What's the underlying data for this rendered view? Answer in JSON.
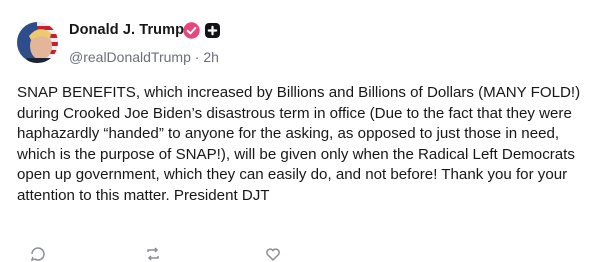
{
  "post": {
    "author": {
      "display_name": "Donald J. Trump",
      "handle": "@realDonaldTrump",
      "separator": "·",
      "time_ago": "2h",
      "avatar_icon": "profile-photo",
      "verified_icon": "verified-badge-icon",
      "plus_icon": "plus-badge-icon",
      "verified_color": "#e8457a"
    },
    "text": "SNAP BENEFITS, which increased by Billions and Billions of Dollars (MANY FOLD!) during Crooked Joe Biden’s disastrous term in office (Due to the fact that they were haphazardly “handed” to anyone for the asking, as opposed to just those in need, which is the purpose of SNAP!), will be given only when the Radical Left Democrats open up government, which they can easily do, and not before! Thank you for your attention to this matter. President DJT",
    "actions": {
      "reply_icon": "comment-icon",
      "repost_icon": "repost-icon",
      "like_icon": "heart-icon"
    }
  }
}
